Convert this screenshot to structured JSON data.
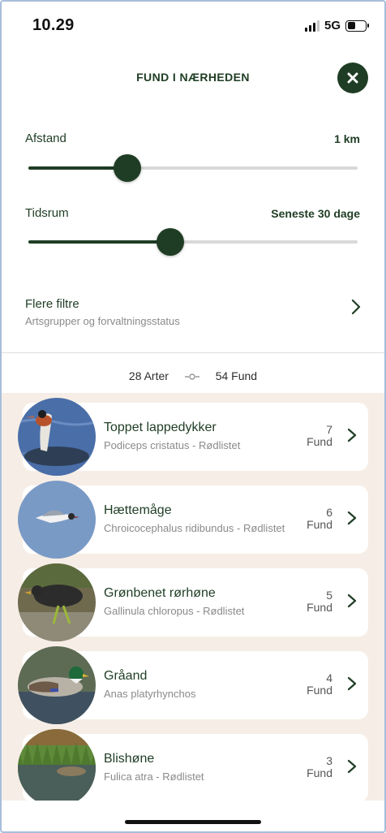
{
  "status_bar": {
    "time": "10.29",
    "network": "5G"
  },
  "header": {
    "title": "FUND I NÆRHEDEN"
  },
  "filters": {
    "distance": {
      "label": "Afstand",
      "value": "1 km",
      "level_percent": 30
    },
    "period": {
      "label": "Tidsrum",
      "value": "Seneste 30 dage",
      "level_percent": 43
    }
  },
  "more_filters": {
    "title": "Flere filtre",
    "subtitle": "Artsgrupper og forvaltningsstatus"
  },
  "summary": {
    "species": "28 Arter",
    "findings": "54 Fund"
  },
  "species": [
    {
      "name": "Toppet lappedykker",
      "subtitle": "Podiceps cristatus - Rødlistet",
      "count": "7",
      "count_label": "Fund"
    },
    {
      "name": "Hættemåge",
      "subtitle": "Chroicocephalus ridibundus - Rødlistet",
      "count": "6",
      "count_label": "Fund"
    },
    {
      "name": "Grønbenet rørhøne",
      "subtitle": "Gallinula chloropus - Rødlistet",
      "count": "5",
      "count_label": "Fund"
    },
    {
      "name": "Gråand",
      "subtitle": "Anas platyrhynchos",
      "count": "4",
      "count_label": "Fund"
    },
    {
      "name": "Blishøne",
      "subtitle": "Fulica atra - Rødlistet",
      "count": "3",
      "count_label": "Fund"
    }
  ],
  "colors": {
    "accent": "#1f3d24",
    "list_background": "#f6eee6",
    "track": "#d9d9d9"
  }
}
